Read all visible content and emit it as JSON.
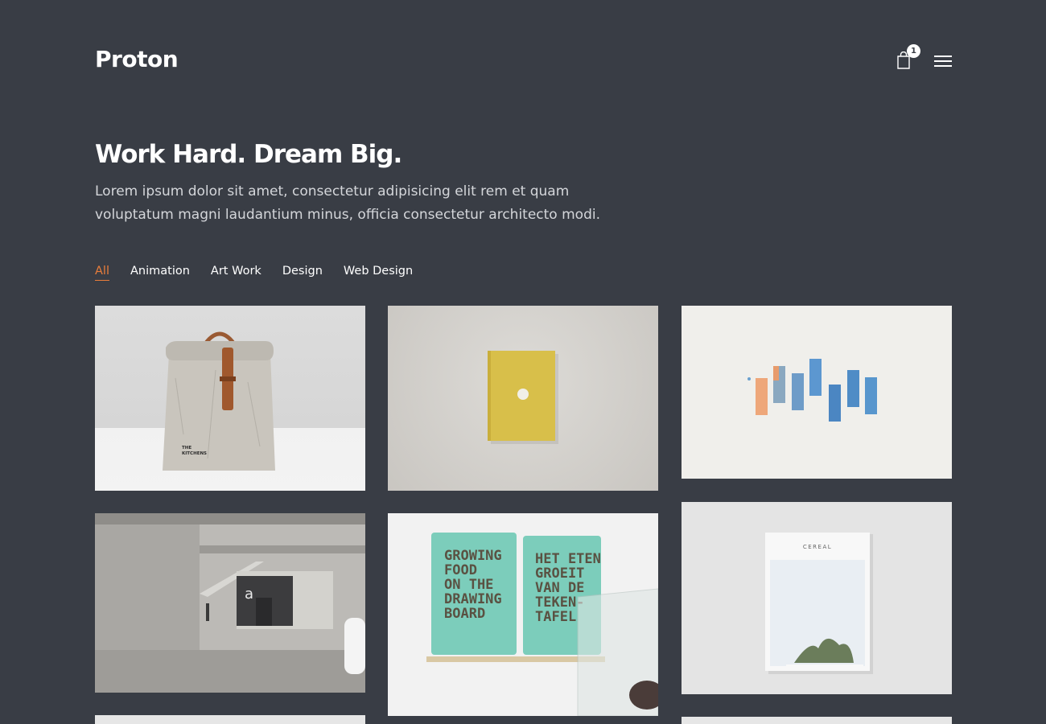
{
  "header": {
    "logo": "Proton",
    "cart_count": "1"
  },
  "hero": {
    "title": "Work Hard. Dream Big.",
    "text": "Lorem ipsum dolor sit amet, consectetur adipisicing elit rem et quam voluptatum magni laudantium minus, officia consectetur architecto modi."
  },
  "filters": [
    {
      "label": "All",
      "active": true
    },
    {
      "label": "Animation",
      "active": false
    },
    {
      "label": "Art Work",
      "active": false
    },
    {
      "label": "Design",
      "active": false
    },
    {
      "label": "Web Design",
      "active": false
    }
  ],
  "portfolio": {
    "bag_print": [
      "THE",
      "KITCHENS"
    ],
    "poster_left": [
      "GROWING",
      "FOOD",
      "ON THE",
      "DRAWING",
      "BOARD"
    ],
    "poster_right": [
      "HET ETEN",
      "GROEIT",
      "VAN DE",
      "TEKEN-",
      "TAFEL"
    ],
    "book_title": "CEREAL",
    "building_letter": "a"
  },
  "colors": {
    "background": "#393d45",
    "accent": "#e97d3b",
    "text": "#ffffff"
  }
}
